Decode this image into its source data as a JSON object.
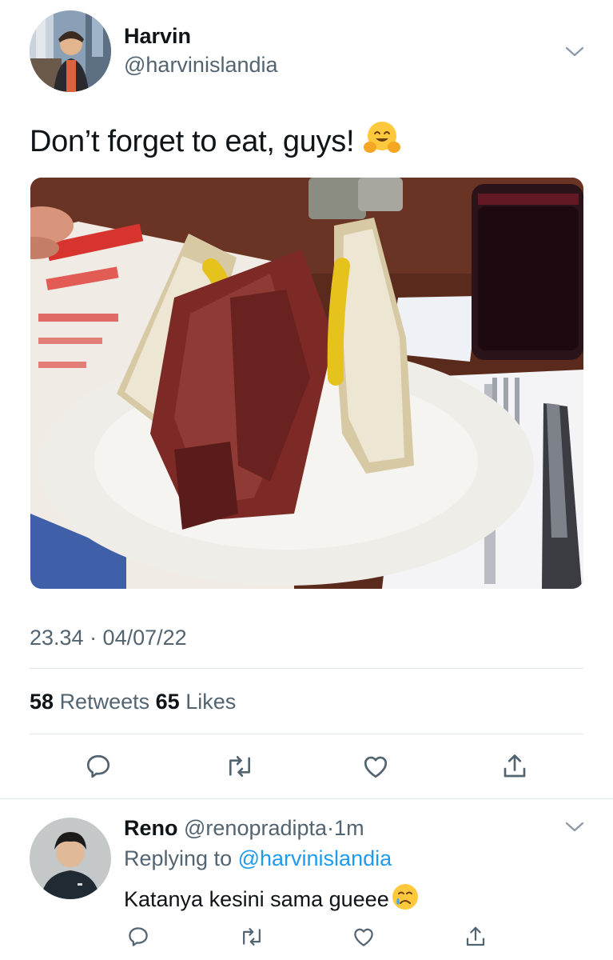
{
  "tweet": {
    "author_name": "Harvin",
    "author_handle": "@harvinislandia",
    "text": "Don’t forget to eat, guys!",
    "emoji": "hugging-face-emoji",
    "timestamp": "23.34 · 04/07/22",
    "retweets_count": "58",
    "retweets_label": "Retweets",
    "likes_count": "65",
    "likes_label": "Likes",
    "photo_subject": "sandwich-photo"
  },
  "actions": [
    "reply-icon",
    "retweet-icon",
    "like-icon",
    "share-icon"
  ],
  "reply": {
    "author_name": "Reno",
    "author_handle": "@renopradipta",
    "separator": "·",
    "age": "1m",
    "replying_prefix": "Replying to",
    "replying_to": "@harvinislandia",
    "text": "Katanya kesini sama gueee",
    "emoji": "crying-face-emoji"
  },
  "colors": {
    "text_primary": "#0f1419",
    "text_secondary": "#536471",
    "link": "#1d9bf0",
    "divider": "#e1e6ea"
  }
}
